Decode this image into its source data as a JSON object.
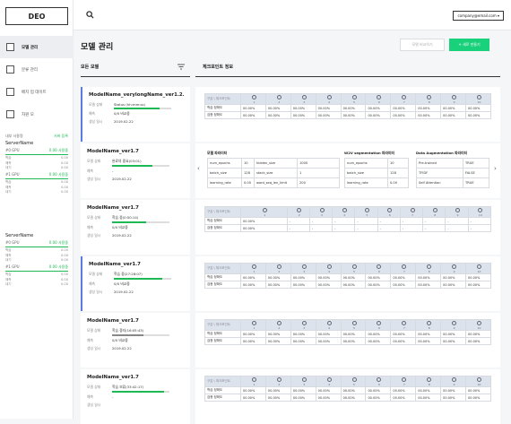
{
  "sidebar": {
    "logo": "DEO",
    "items": [
      {
        "label": "모델 관리",
        "active": true
      },
      {
        "label": "분류 관리",
        "active": false
      },
      {
        "label": "배치 업 데이트",
        "active": false
      },
      {
        "label": "자원 모",
        "active": false
      }
    ],
    "resources_title": "내부 사용량",
    "resources_link": "서버 등록",
    "servers": [
      {
        "name": "ServerName",
        "gpus": [
          {
            "label": "#0 GPU",
            "value": "0.00 사용중"
          },
          {
            "label": "#1 GPU",
            "value": "0.00 사용중"
          }
        ]
      },
      {
        "name": "ServerName",
        "gpus": [
          {
            "label": "#0 GPU",
            "value": "0.00 사용중"
          },
          {
            "label": "#1 GPU",
            "value": "0.00 사용중"
          }
        ]
      }
    ],
    "kv_labels": [
      "학습",
      "예측",
      "대기"
    ],
    "kv_value": "0.00"
  },
  "topbar": {
    "search_placeholder": "",
    "account": "company@email.com ▾"
  },
  "page": {
    "title": "모델 관리",
    "compare_button": "모델 비교하기",
    "new_button": "+ 새로 만들기",
    "models_header": "모든 모델",
    "checkpoint_header": "체크포인트 정보"
  },
  "models": [
    {
      "name": "ModelName_verylongName_ver1.2...",
      "status_label": "모델 상태",
      "status": "Status (hh:mm:ss)",
      "progress": 0.8,
      "bar": "green",
      "predict_label": "예측",
      "predict": "0/0 비교중",
      "date_label": "생성 일시",
      "date": "2019.02.22",
      "selected": true
    },
    {
      "name": "ModelName_ver1.7",
      "status_label": "모델 상태",
      "status": "완료의 중요(03:01)",
      "progress": 0.7,
      "bar": "green",
      "predict_label": "예측",
      "predict": "-",
      "date_label": "생성 일시",
      "date": "2019.02.22",
      "selected": false
    },
    {
      "name": "ModelName_ver1.7",
      "status_label": "모델 상태",
      "status": "학습 중(0:50:14)",
      "progress": 0.6,
      "bar": "green",
      "predict_label": "예측",
      "predict": "0/0 비교중",
      "date_label": "생성 일시",
      "date": "2019.02.22",
      "selected": false
    },
    {
      "name": "ModelName_ver1.7",
      "status_label": "모델 상태",
      "status": "학습 중(27:28:07)",
      "progress": 0.85,
      "bar": "green",
      "predict_label": "예측",
      "predict": "0/0 비교중",
      "date_label": "생성 일시",
      "date": "2019.02.22",
      "selected": true
    },
    {
      "name": "ModelName_ver1.7",
      "status_label": "모델 상태",
      "status": "학습 중지(16:05:43)",
      "progress": 0.55,
      "bar": "grey",
      "predict_label": "예측",
      "predict": "0/0 비교중",
      "date_label": "생성 일시",
      "date": "2019.02.22",
      "selected": false
    },
    {
      "name": "ModelName_ver1.7",
      "status_label": "모델 상태",
      "status": "학습 보류(33:42:17)",
      "progress": 0.9,
      "bar": "green",
      "predict_label": "예측",
      "predict": "-",
      "date_label": "생성 일시",
      "date": "",
      "selected": false
    }
  ],
  "checkpoint": {
    "header_label": "구분 \\ 체크포인트",
    "columns": [
      "1",
      "2",
      "3",
      "4",
      "5",
      "6",
      "7",
      "8",
      "9",
      "10"
    ],
    "row_labels": [
      "학습 정확도",
      "검증 정확도"
    ],
    "full": [
      "00.00%",
      "00.00%",
      "00.00%",
      "00.00%",
      "00.00%",
      "00.00%",
      "00.00%",
      "00.00%",
      "00.00%",
      "00.00%"
    ],
    "partial": [
      "00.00%",
      "-",
      "-",
      "-",
      "-",
      "-",
      "-",
      "-",
      "-",
      "-"
    ]
  },
  "params": {
    "groups": [
      {
        "title": "모델 파라미터",
        "rows": [
          [
            "num_epochs",
            "10",
            "hidden_size",
            "1000"
          ],
          [
            "batch_size",
            "128",
            "stack_size",
            "1"
          ],
          [
            "learning_rate",
            "0.00",
            "word_seq_len_limit",
            "200"
          ]
        ]
      },
      {
        "title": "W2V segmentation 파라미터",
        "rows": [
          [
            "num_epochs",
            "10"
          ],
          [
            "batch_size",
            "128"
          ],
          [
            "learning_rate",
            "0.00"
          ]
        ]
      },
      {
        "title": "Data Augmentation 파라미터",
        "rows": [
          [
            "Pre-trained",
            "TRUE"
          ],
          [
            "TFIDF",
            "FALSE"
          ],
          [
            "Self Attention",
            "TRUE"
          ]
        ]
      }
    ],
    "prev": "‹",
    "next": "›"
  }
}
